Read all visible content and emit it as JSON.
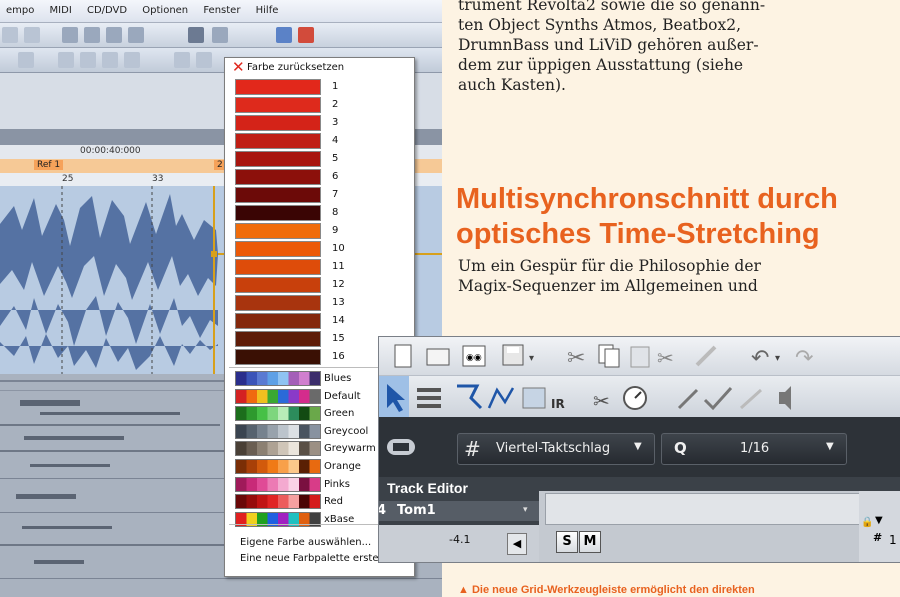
{
  "daw": {
    "menu": [
      "empo",
      "MIDI",
      "CD/DVD",
      "Optionen",
      "Fenster",
      "Hilfe"
    ],
    "timecode": "00:00:40:000",
    "marker": "Ref 1",
    "marker_right": "2",
    "bar_numbers": [
      "25",
      "33"
    ]
  },
  "color_menu": {
    "reset_label": "Farbe zurücksetzen",
    "swatches": [
      {
        "label": "1",
        "color": "#e2281b"
      },
      {
        "label": "2",
        "color": "#de2a1c"
      },
      {
        "label": "3",
        "color": "#d42318"
      },
      {
        "label": "4",
        "color": "#c01e15"
      },
      {
        "label": "5",
        "color": "#a8160f"
      },
      {
        "label": "6",
        "color": "#8c100b"
      },
      {
        "label": "7",
        "color": "#6c0a08"
      },
      {
        "label": "8",
        "color": "#3a0504"
      },
      {
        "label": "9",
        "color": "#f06c0a"
      },
      {
        "label": "10",
        "color": "#ec5a08"
      },
      {
        "label": "11",
        "color": "#de4c0a"
      },
      {
        "label": "12",
        "color": "#c8400c"
      },
      {
        "label": "13",
        "color": "#a8340e"
      },
      {
        "label": "14",
        "color": "#84280c"
      },
      {
        "label": "15",
        "color": "#5e1c08"
      },
      {
        "label": "16",
        "color": "#3a1004"
      }
    ],
    "palettes": [
      {
        "name": "Blues",
        "colors": [
          "#2a2e8c",
          "#3b54b8",
          "#5a7ad2",
          "#5ea0e6",
          "#8fc3f2",
          "#a45fb8",
          "#d07fcf",
          "#3c2e6c"
        ]
      },
      {
        "name": "Default",
        "colors": [
          "#d42222",
          "#f06a10",
          "#f0c020",
          "#3aa832",
          "#2a6ad8",
          "#8a3ac8",
          "#d42c8c",
          "#6a6a6a"
        ]
      },
      {
        "name": "Green",
        "colors": [
          "#1c6e1c",
          "#2e9a2e",
          "#46c046",
          "#7ed67e",
          "#b8ecb8",
          "#2c8c5c",
          "#124a12",
          "#6aa84a"
        ]
      },
      {
        "name": "Greycool",
        "colors": [
          "#3a4450",
          "#56626e",
          "#76828e",
          "#98a2ac",
          "#bcc4cc",
          "#dce0e4",
          "#4a5460",
          "#8892a0"
        ]
      },
      {
        "name": "Greywarm",
        "colors": [
          "#4a4036",
          "#6a5e52",
          "#8c8072",
          "#aea294",
          "#cfc5b8",
          "#ebe5dc",
          "#5a5046",
          "#9c9084"
        ]
      },
      {
        "name": "Orange",
        "colors": [
          "#7a2e06",
          "#a84008",
          "#d25a0c",
          "#f07a16",
          "#f8a04a",
          "#fcc88a",
          "#5a2004",
          "#e86a10"
        ]
      },
      {
        "name": "Pinks",
        "colors": [
          "#a01a5a",
          "#c82a78",
          "#e04a96",
          "#ec7ab4",
          "#f4aad0",
          "#fad2e6",
          "#7a1040",
          "#d83c88"
        ]
      },
      {
        "name": "Red",
        "colors": [
          "#6a0808",
          "#960c0c",
          "#c01414",
          "#e02424",
          "#ec5c5c",
          "#f6a0a0",
          "#4a0404",
          "#d41c1c"
        ]
      },
      {
        "name": "xBase",
        "colors": [
          "#e02020",
          "#f0d020",
          "#20a020",
          "#2060e0",
          "#a020c0",
          "#20c0c0",
          "#e06010",
          "#404040"
        ]
      }
    ],
    "action_pick": "Eigene Farbe auswählen...",
    "action_new": "Eine neue Farbpalette erstellen..."
  },
  "article": {
    "lines_top": [
      "trument Revolta2 sowie die so genann-",
      "ten Object Synths Atmos, Beatbox2,",
      "DrumnBass und LiViD gehören außer-",
      "dem zur üppigen Ausstattung (siehe",
      "auch Kasten)."
    ],
    "heading_1": "Multisynchronschnitt durch",
    "heading_2": "optisches Time-Stretching",
    "lines_mid": [
      "Um ein Gespür für die Philosophie der",
      "Magix-Sequenzer im Allgemeinen und"
    ],
    "caption": "▲ Die neue Grid-Werkzeugleiste ermöglicht den direkten"
  },
  "inset": {
    "grid_value": "Viertel-Taktschlag",
    "q_label": "Q",
    "q_value": "1/16",
    "track_editor_title": "Track Editor",
    "track_number": "4",
    "track_name": "Tom1",
    "track_value": "-4.1",
    "solo_label": "S",
    "mute_label": "M",
    "right_number": "1"
  }
}
